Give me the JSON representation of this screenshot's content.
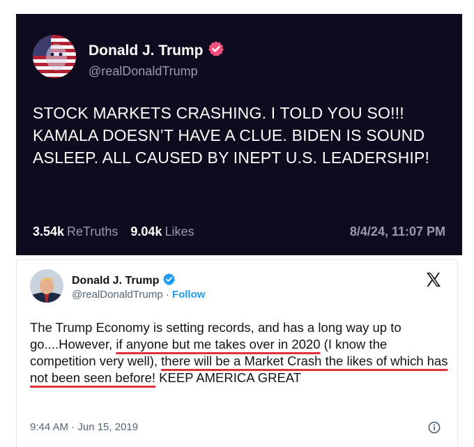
{
  "truth_post": {
    "author_name": "Donald J. Trump",
    "handle": "@realDonaldTrump",
    "body": "STOCK MARKETS CRASHING. I TOLD YOU SO!!! KAMALA DOESN’T HAVE A CLUE. BIDEN IS SOUND ASLEEP. ALL CAUSED BY INEPT U.S. LEADERSHIP!",
    "retruths_count": "3.54k",
    "retruths_label": "ReTruths",
    "likes_count": "9.04k",
    "likes_label": "Likes",
    "timestamp": "8/4/24, 11:07 PM",
    "verified_color": "#f0507f",
    "background_color": "#0f0b1e"
  },
  "x_post": {
    "author_name": "Donald J. Trump",
    "handle": "@realDonaldTrump",
    "separator": " · ",
    "follow_label": "Follow",
    "body_parts": {
      "p1": "The Trump Economy is setting records, and has a long way up to go....However, ",
      "p2": "if anyone but me takes over in 2020",
      "p3": " (I know the competition very well), ",
      "p4": "there will be a Market Crash the likes of which has not been seen before!",
      "p5": " KEEP AMERICA GREAT"
    },
    "timestamp": "9:44 AM · Jun 15, 2019",
    "verified_color": "#1d9bf0",
    "underline_color": "#e0303a",
    "logo_icon": "x-logo-icon",
    "info_icon": "info-icon"
  }
}
